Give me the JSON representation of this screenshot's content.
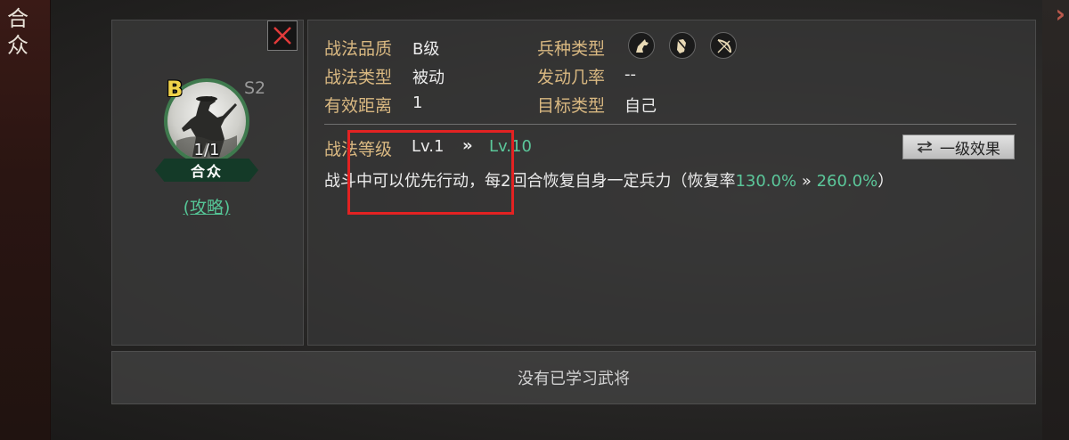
{
  "sidebar": {
    "title": "合众"
  },
  "skill": {
    "grade": "B",
    "season": "S2",
    "count": "1/1",
    "name": "合众",
    "guide_link": "(攻略)"
  },
  "info": {
    "quality_label": "战法品质",
    "quality_value": "B级",
    "type_label": "战法类型",
    "type_value": "被动",
    "range_label": "有效距离",
    "range_value": "1",
    "troop_label": "兵种类型",
    "troop_icons": [
      "cavalry-icon",
      "shield-icon",
      "bow-icon"
    ],
    "rate_label": "发动几率",
    "rate_value": "--",
    "target_label": "目标类型",
    "target_value": "自己"
  },
  "level": {
    "label": "战法等级",
    "from": "Lv.1",
    "arrow": "»",
    "to": "Lv.10",
    "effect_button": "一级效果"
  },
  "description": {
    "text": "战斗中可以优先行动，每2回合恢复自身一定兵力（恢复率",
    "value_from": "130.0%",
    "arrow": "»",
    "value_to": "260.0%",
    "suffix": "）"
  },
  "bottom": {
    "message": "没有已学习武将"
  },
  "colors": {
    "label_gold": "#d9b881",
    "accent_green": "#5bc79a",
    "highlight_red": "#e32222",
    "grade_yellow": "#f0d24a"
  }
}
